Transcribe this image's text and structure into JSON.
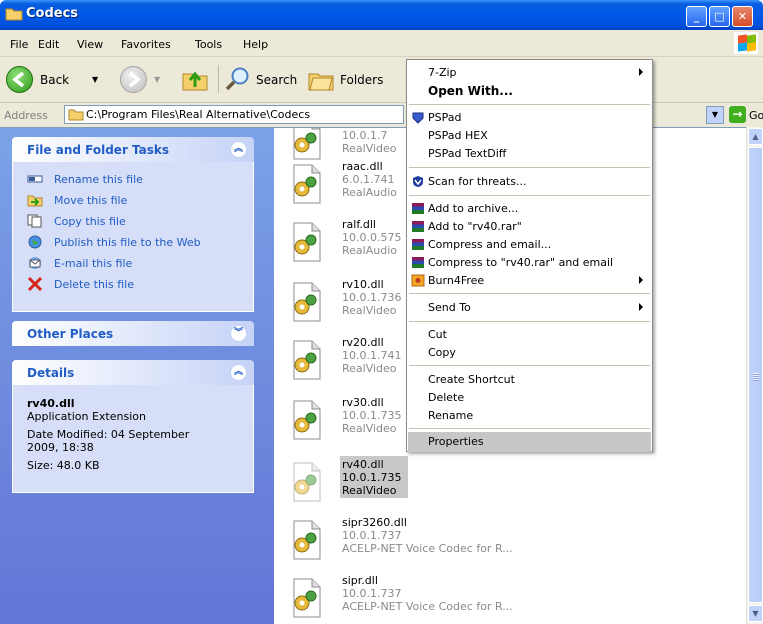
{
  "window": {
    "title": "Codecs"
  },
  "menubar": [
    "File",
    "Edit",
    "View",
    "Favorites",
    "Tools",
    "Help"
  ],
  "toolbar": {
    "back_label": "Back",
    "search_label": "Search",
    "folders_label": "Folders"
  },
  "address": {
    "label": "Address",
    "value": "C:\\Program Files\\Real Alternative\\Codecs",
    "go_label": "Go"
  },
  "tasks_panel": {
    "title": "File and Folder Tasks",
    "items": [
      "Rename this file",
      "Move this file",
      "Copy this file",
      "Publish this file to the Web",
      "E-mail this file",
      "Delete this file"
    ]
  },
  "other_places": {
    "title": "Other Places"
  },
  "details": {
    "title": "Details",
    "filename": "rv40.dll",
    "type": "Application Extension",
    "modified_line1": "Date Modified: 04 September",
    "modified_line2": "2009, 18:38",
    "size": "Size: 48.0 KB"
  },
  "files": [
    {
      "name": "",
      "version": "10.0.1.7",
      "desc": "RealVideo"
    },
    {
      "name": "raac.dll",
      "version": "6.0.1.741",
      "desc": "RealAudio"
    },
    {
      "name": "ralf.dll",
      "version": "10.0.0.575",
      "desc": "RealAudio"
    },
    {
      "name": "rv10.dll",
      "version": "10.0.1.736",
      "desc": "RealVideo"
    },
    {
      "name": "rv20.dll",
      "version": "10.0.1.741",
      "desc": "RealVideo"
    },
    {
      "name": "rv30.dll",
      "version": "10.0.1.735",
      "desc": "RealVideo"
    },
    {
      "name": "rv40.dll",
      "version": "10.0.1.735",
      "desc": "RealVideo"
    },
    {
      "name": "sipr3260.dll",
      "version": "10.0.1.737",
      "desc": "ACELP-NET Voice Codec for R..."
    },
    {
      "name": "sipr.dll",
      "version": "10.0.1.737",
      "desc": "ACELP-NET Voice Codec for R..."
    }
  ],
  "context_menu": {
    "items": [
      "7-Zip",
      "Open With...",
      "PSPad",
      "PSPad HEX",
      "PSPad TextDiff",
      "Scan for threats...",
      "Add to archive...",
      "Add to \"rv40.rar\"",
      "Compress and email...",
      "Compress to \"rv40.rar\" and email",
      "Burn4Free",
      "Send To",
      "Cut",
      "Copy",
      "Create Shortcut",
      "Delete",
      "Rename",
      "Properties"
    ]
  },
  "colors": {
    "title_bar": "#0058e8",
    "task_pane": "#7ba2e7",
    "link_text": "#215dc6",
    "highlight": "#c7c7c7"
  }
}
